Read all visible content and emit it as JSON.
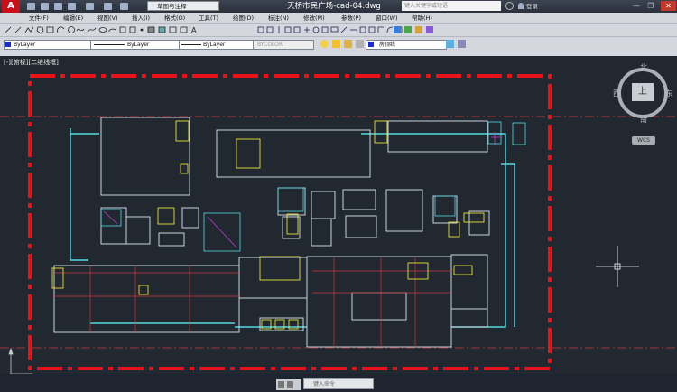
{
  "app": {
    "logo": "A"
  },
  "titlebar": {
    "workspace": "草图与注释",
    "document_title": "天桥市民广场-cad-04.dwg",
    "search_placeholder": "键入关键字或短语",
    "login": "登录",
    "minimize": "—",
    "restore": "❐",
    "close": "✕"
  },
  "menu": {
    "items": [
      "文件(F)",
      "编辑(E)",
      "视图(V)",
      "插入(I)",
      "格式(O)",
      "工具(T)",
      "绘图(D)",
      "标注(N)",
      "修改(M)",
      "参数(P)",
      "窗口(W)",
      "帮助(H)"
    ]
  },
  "properties": {
    "layer_color": "ByLayer",
    "linetype": "ByLayer",
    "lineweight": "ByLayer",
    "plot_style": "BYCOLOR",
    "current_layer": "房顶线"
  },
  "viewport": {
    "label": "[-][俯视][二维线框]"
  },
  "viewcube": {
    "north": "北",
    "south": "南",
    "east": "东",
    "west": "西",
    "top": "上",
    "wcs": "WCS"
  },
  "command": {
    "placeholder": "键入命令"
  },
  "colors": {
    "border_red": "#e8131a",
    "wall": "#c9d2dc",
    "cyan": "#57d9e6",
    "yellow": "#e8e03a",
    "red_line": "#c93a3a",
    "magenta": "#c03ad0"
  }
}
